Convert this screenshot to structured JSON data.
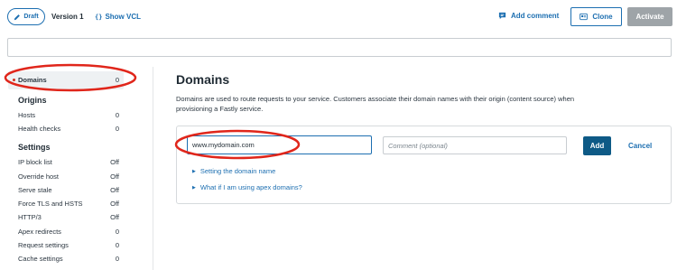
{
  "topbar": {
    "draft_label": "Draft",
    "version_label": "Version 1",
    "show_vcl_icon": "{}",
    "show_vcl_label": "Show VCL",
    "add_comment_label": "Add comment",
    "clone_label": "Clone",
    "activate_label": "Activate"
  },
  "sidebar": {
    "active_item": {
      "label": "Domains",
      "count": "0"
    },
    "sections": [
      {
        "heading": "Origins",
        "items": [
          {
            "label": "Hosts",
            "value": "0"
          },
          {
            "label": "Health checks",
            "value": "0"
          }
        ]
      },
      {
        "heading": "Settings",
        "items": [
          {
            "label": "IP block list",
            "value": "Off"
          },
          {
            "label": "Override host",
            "value": "Off"
          },
          {
            "label": "Serve stale",
            "value": "Off"
          },
          {
            "label": "Force TLS and HSTS",
            "value": "Off"
          },
          {
            "label": "HTTP/3",
            "value": "Off"
          },
          {
            "label": "Apex redirects",
            "value": "0"
          },
          {
            "label": "Request settings",
            "value": "0"
          },
          {
            "label": "Cache settings",
            "value": "0"
          }
        ]
      }
    ]
  },
  "main": {
    "title": "Domains",
    "description": "Domains are used to route requests to your service. Customers associate their domain names with their origin (content source) when provisioning a Fastly service.",
    "form": {
      "domain_value": "www.mydomain.com",
      "comment_placeholder": "Comment (optional)",
      "add_label": "Add",
      "cancel_label": "Cancel"
    },
    "help_links": [
      "Setting the domain name",
      "What if I am using apex domains?"
    ]
  },
  "colors": {
    "accent": "#1d6fb1",
    "primary_button": "#0e5a86",
    "disabled_button": "#9ea4a8",
    "annotation": "#e0261b"
  }
}
